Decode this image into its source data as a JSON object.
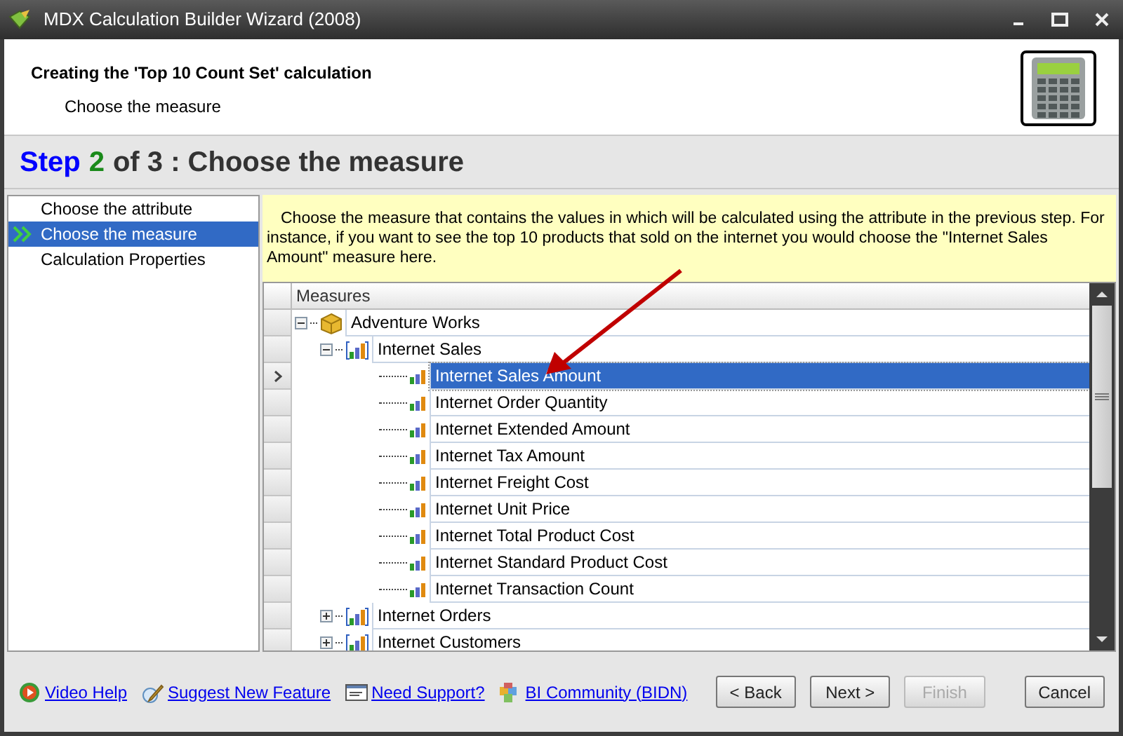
{
  "window": {
    "title": "MDX Calculation Builder Wizard (2008)"
  },
  "header": {
    "title": "Creating the 'Top 10 Count Set' calculation",
    "subtitle": "Choose the measure"
  },
  "step": {
    "word": "Step",
    "number": "2",
    "rest": "of 3 : Choose the measure"
  },
  "sidebar": {
    "items": [
      {
        "label": "Choose the attribute",
        "selected": false
      },
      {
        "label": "Choose the measure",
        "selected": true
      },
      {
        "label": "Calculation Properties",
        "selected": false
      }
    ]
  },
  "info": "Choose the measure that contains the values in which will be calculated using the attribute in the previous step. For instance, if you want to see the top 10 products that sold on the internet you would choose the \"Internet Sales Amount\" measure here.",
  "grid": {
    "column": "Measures",
    "tree": [
      {
        "kind": "cube",
        "label": "Adventure Works",
        "expanded": true,
        "selected": false,
        "children": [
          {
            "kind": "group",
            "label": "Internet Sales",
            "expanded": true,
            "selected": false,
            "children": [
              {
                "kind": "measure",
                "label": "Internet Sales Amount",
                "selected": true
              },
              {
                "kind": "measure",
                "label": "Internet Order Quantity",
                "selected": false
              },
              {
                "kind": "measure",
                "label": "Internet Extended Amount",
                "selected": false
              },
              {
                "kind": "measure",
                "label": "Internet Tax Amount",
                "selected": false
              },
              {
                "kind": "measure",
                "label": "Internet Freight Cost",
                "selected": false
              },
              {
                "kind": "measure",
                "label": "Internet Unit Price",
                "selected": false
              },
              {
                "kind": "measure",
                "label": "Internet Total Product Cost",
                "selected": false
              },
              {
                "kind": "measure",
                "label": "Internet Standard Product Cost",
                "selected": false
              },
              {
                "kind": "measure",
                "label": "Internet Transaction Count",
                "selected": false
              }
            ]
          },
          {
            "kind": "group",
            "label": "Internet Orders",
            "expanded": false,
            "selected": false
          },
          {
            "kind": "group",
            "label": "Internet Customers",
            "expanded": false,
            "selected": false
          }
        ]
      }
    ]
  },
  "footer": {
    "links": [
      {
        "kind": "video",
        "label": "Video Help"
      },
      {
        "kind": "suggest",
        "label": "Suggest New Feature"
      },
      {
        "kind": "support",
        "label": "Need Support?"
      },
      {
        "kind": "community",
        "label": "BI Community (BIDN)"
      }
    ],
    "buttons": [
      {
        "label": "< Back",
        "disabled": false
      },
      {
        "label": "Next >",
        "disabled": false
      },
      {
        "label": "Finish",
        "disabled": true
      },
      {
        "label": "Cancel",
        "disabled": false
      }
    ]
  }
}
